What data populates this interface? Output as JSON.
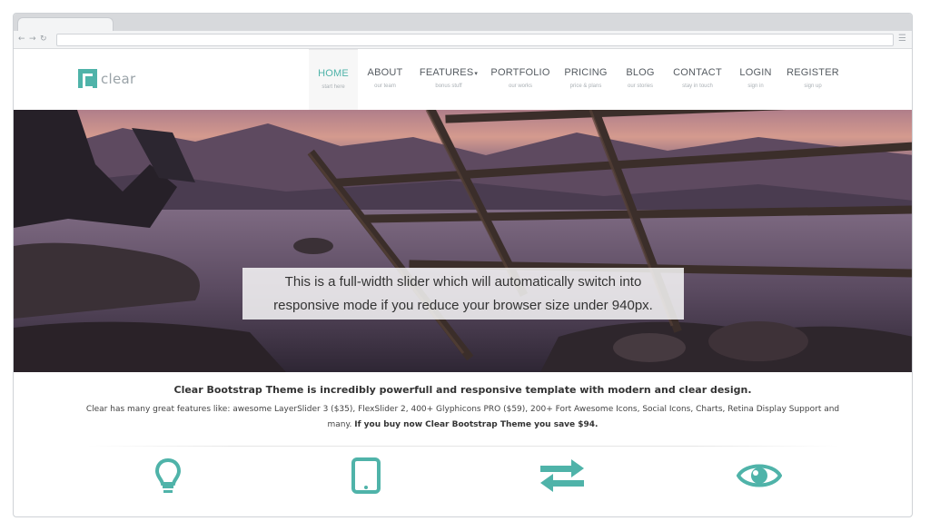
{
  "header": {
    "logo_text": "clear",
    "nav": [
      {
        "label": "HOME",
        "sub": "start here",
        "active": true
      },
      {
        "label": "ABOUT",
        "sub": "our team"
      },
      {
        "label": "FEATURES",
        "sub": "bonus stuff",
        "dropdown": true
      },
      {
        "label": "PORTFOLIO",
        "sub": "our works"
      },
      {
        "label": "PRICING",
        "sub": "price & plans"
      },
      {
        "label": "BLOG",
        "sub": "our stories"
      },
      {
        "label": "CONTACT",
        "sub": "stay in touch"
      },
      {
        "label": "LOGIN",
        "sub": "sign in"
      },
      {
        "label": "REGISTER",
        "sub": "sign up"
      }
    ]
  },
  "slider": {
    "caption_line1": "This is a full-width slider which will automatically switch into",
    "caption_line2": "responsive mode if you reduce your browser size under 940px."
  },
  "intro": {
    "title": "Clear Bootstrap Theme is incredibly powerfull and responsive template with modern and clear design.",
    "text": "Clear has many great features like: awesome LayerSlider 3 ($35), FlexSlider 2, 400+ Glyphicons PRO ($59), 200+ Fort Awesome Icons, Social Icons, Charts, Retina Display Support and many.",
    "highlight": "If you buy now Clear Bootstrap Theme you save $94."
  },
  "features": {
    "icons": [
      "lightbulb-icon",
      "tablet-icon",
      "exchange-icon",
      "eye-icon"
    ]
  },
  "colors": {
    "accent": "#4fb3a9",
    "nav_text": "#555b61",
    "caption_bg": "#ffffff"
  }
}
